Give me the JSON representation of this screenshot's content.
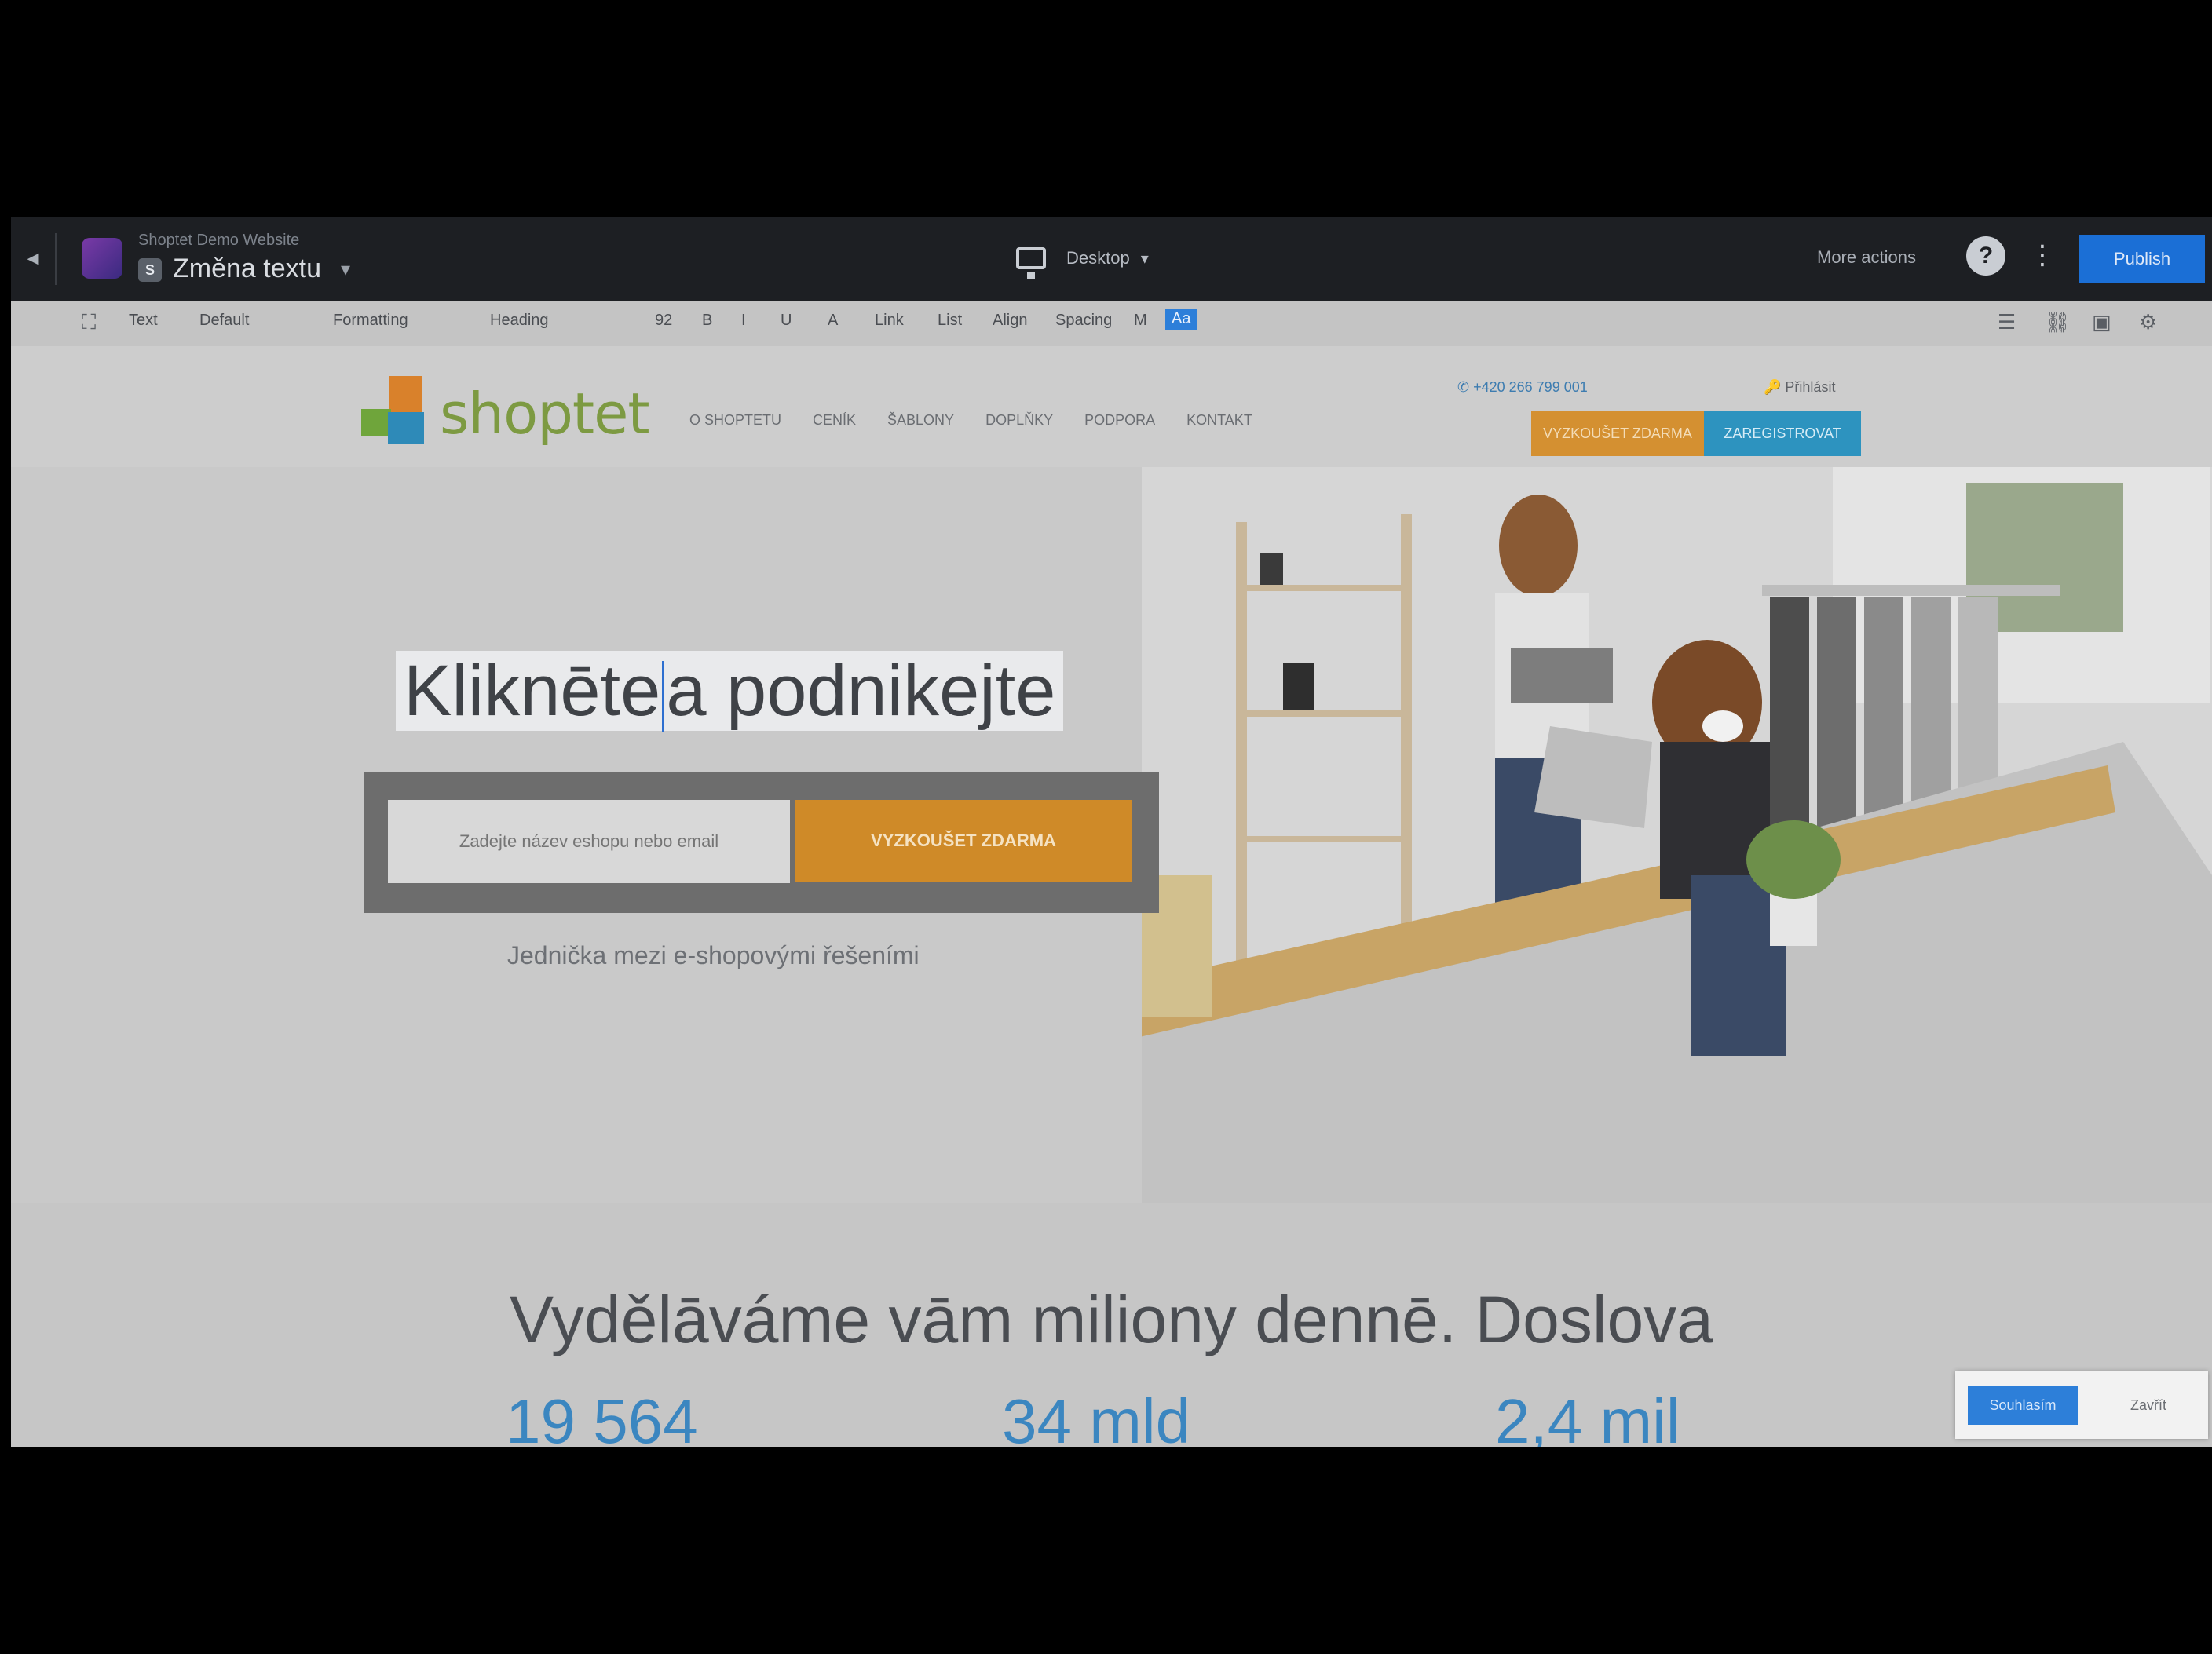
{
  "editor": {
    "site_name": "Shoptet Demo Website",
    "page_name": "Změna textu",
    "page_icon": "S",
    "device_label": "Desktop",
    "more_link": "More actions",
    "publish_label": "Publish"
  },
  "toolbar": {
    "items": [
      "Text",
      "Default",
      "Formatting",
      "Heading",
      "92",
      "B",
      "I",
      "U",
      "A",
      "Link",
      "List",
      "Align",
      "Spacing",
      "M",
      "Aa"
    ]
  },
  "site": {
    "logo_text": "shoptet",
    "nav": [
      "O SHOPTETU",
      "CENÍK",
      "ŠABLONY",
      "DOPLŇKY",
      "PODPORA",
      "KONTAKT"
    ],
    "phone": "+420 266 799 001",
    "login": "Přihlásit",
    "cta_primary": "VYZKOUŠET ZDARMA",
    "cta_secondary": "ZAREGISTROVAT"
  },
  "hero": {
    "title_part1": "Kliknēte",
    "title_part2": "a podnikejte",
    "input_placeholder": "Zadejte název eshopu nebo email",
    "submit_label": "VYZKOUŠET ZDARMA",
    "tagline": "Jednička mezi e-shopovými řešeními"
  },
  "stats": {
    "title": "Vydělāváme vām miliony dennē. Doslova",
    "items": [
      "19 564",
      "34 mld",
      "2,4 mil"
    ]
  },
  "cookie": {
    "ok_label": "Souhlasím",
    "close_label": "Zavřít"
  }
}
